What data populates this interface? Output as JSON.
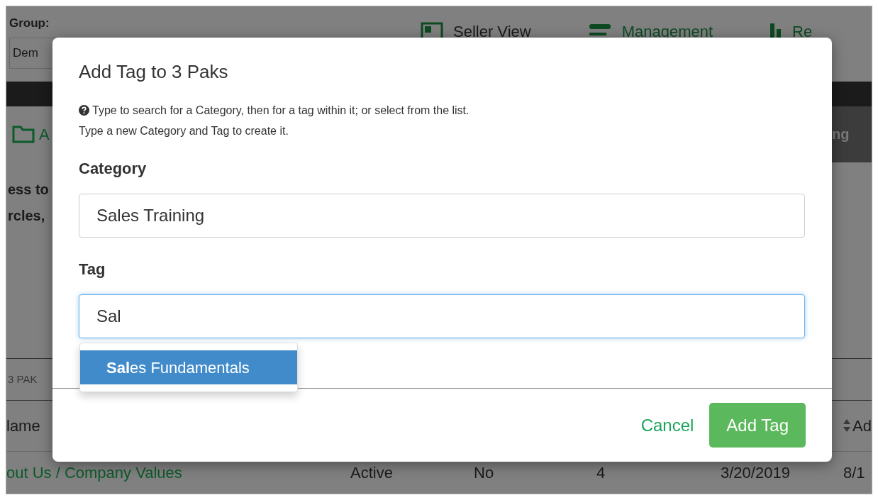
{
  "background": {
    "group_label": "Group:",
    "group_select": "Dem",
    "nav": [
      {
        "label": "Seller View",
        "kind": "monitor"
      },
      {
        "label": "Management",
        "kind": "list"
      },
      {
        "label": "Re",
        "kind": "chart"
      }
    ],
    "left_link": "A",
    "side_tab": "ng",
    "intro_lines": [
      "ess to",
      "rcles,"
    ],
    "count": "3 PAK",
    "table": {
      "first_column_header": {
        "label": "lame",
        "sortable": false
      },
      "last_column_header": {
        "label": "Ad",
        "sortable": true
      },
      "rows": [
        {
          "cells": [
            "out Us / Company Values",
            "Active",
            "No",
            "4",
            "3/20/2019",
            "8/1"
          ]
        }
      ]
    }
  },
  "modal": {
    "title": "Add Tag to 3 Paks",
    "help": [
      "Type to search for a Category, then for a tag within it; or select from the list.",
      "Type a new Category and Tag to create it."
    ],
    "fields": [
      {
        "label": "Category",
        "value": "Sales Training",
        "focused": false
      },
      {
        "label": "Tag",
        "value": "Sal",
        "focused": true
      }
    ],
    "suggestions": [
      {
        "label": "**Sal**es Fundamentals",
        "selected": true
      }
    ],
    "buttons": [
      {
        "label": "Cancel",
        "kind": "link"
      },
      {
        "label": "Add Tag",
        "kind": "primary"
      }
    ]
  }
}
